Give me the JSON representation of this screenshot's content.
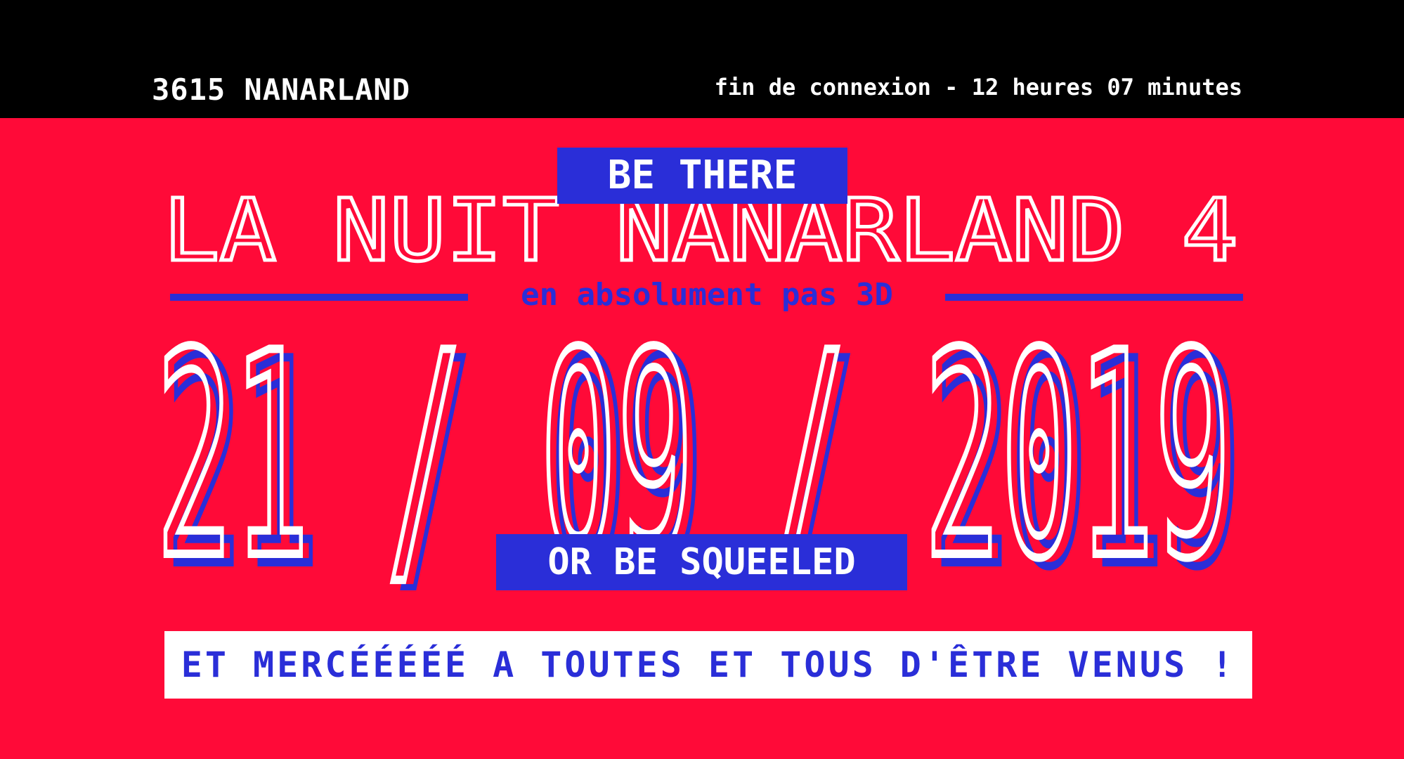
{
  "header": {
    "service": "3615 NANARLAND",
    "session_timer": "fin de connexion - 12 heures 07 minutes"
  },
  "event": {
    "tagline_top": "BE THERE",
    "title": "LA NUIT NANARLAND 4",
    "subtitle": "en absolument pas 3D",
    "date": "21 / 09 / 2019",
    "tagline_bottom": "OR BE SQUEELED",
    "thanks": "ET MERCÉÉÉÉÉ A TOUTES ET TOUS D'ÊTRE VENUS !"
  },
  "colors": {
    "background": "#ff0a38",
    "header": "#000000",
    "accent": "#2a2ed8",
    "text": "#ffffff"
  }
}
